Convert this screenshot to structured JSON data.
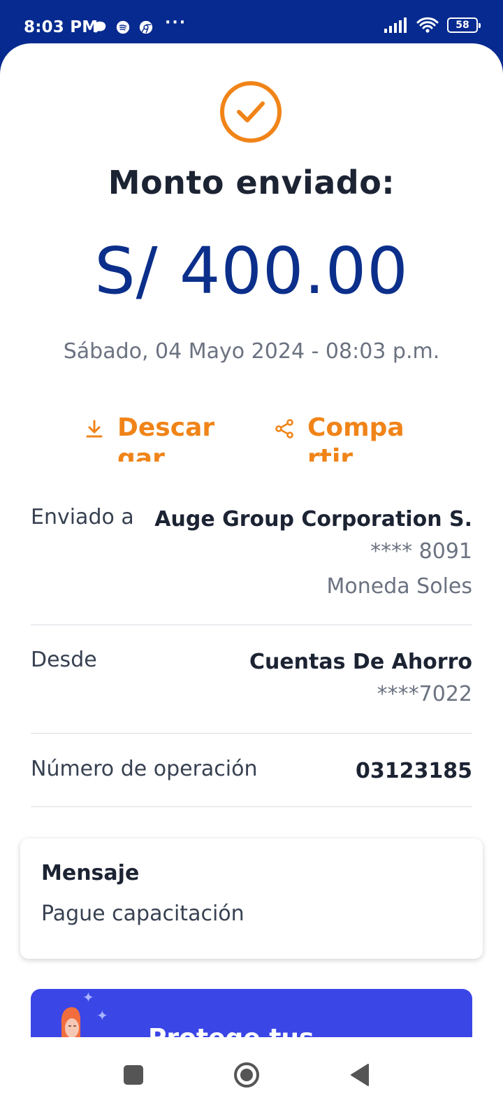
{
  "status_bar": {
    "time": "8:03 PM",
    "dots": "···",
    "battery": "58"
  },
  "header": {
    "title": "Monto enviado:",
    "amount": "S/ 400.00",
    "datetime": "Sábado, 04 Mayo 2024 - 08:03 p.m."
  },
  "actions": {
    "download_label": "Descargar",
    "share_label": "Compartir"
  },
  "details": {
    "sent_to": {
      "label": "Enviado a",
      "name": "Auge Group Corporation S.",
      "account": "**** 8091",
      "currency": "Moneda Soles"
    },
    "from": {
      "label": "Desde",
      "account_type": "Cuentas De Ahorro",
      "account": "****7022"
    },
    "operation": {
      "label": "Número de operación",
      "number": "03123185"
    }
  },
  "message": {
    "title": "Mensaje",
    "text": "Pague capacitación"
  },
  "promo": {
    "text": "Protege tus"
  },
  "colors": {
    "brand_navy": "#062a8f",
    "accent_orange": "#f08418",
    "amount_blue": "#0b2f8a",
    "promo_blue": "#3b46e6"
  }
}
